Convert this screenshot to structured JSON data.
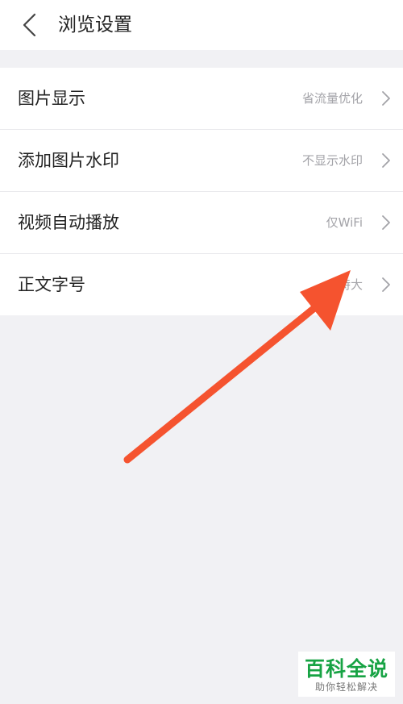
{
  "header": {
    "title": "浏览设置",
    "back_icon": "chevron-left-icon"
  },
  "settings": [
    {
      "label": "图片显示",
      "value": "省流量优化"
    },
    {
      "label": "添加图片水印",
      "value": "不显示水印"
    },
    {
      "label": "视频自动播放",
      "value": "仅WiFi"
    },
    {
      "label": "正文字号",
      "value": "特大"
    }
  ],
  "watermark": {
    "title": "百科全说",
    "subtitle": "助你轻松解决"
  },
  "colors": {
    "arrow": "#f5532f",
    "background": "#f1f1f4",
    "brand_green": "#17a344"
  }
}
